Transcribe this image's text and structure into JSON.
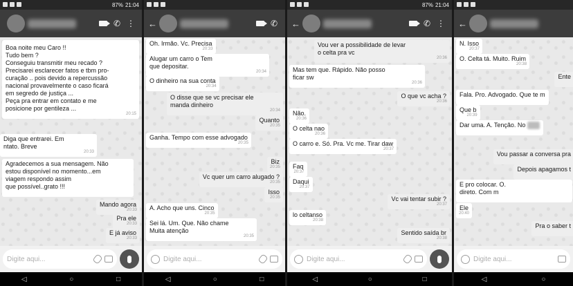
{
  "status": {
    "battery": "87%",
    "time": "21:04"
  },
  "input": {
    "placeholder": "Digite aqui..."
  },
  "nav": {
    "back": "◁",
    "home": "○",
    "recent": "□"
  },
  "panel1": {
    "messages": [
      {
        "dir": "in",
        "text": "Boa noite meu Caro !!\nTudo bem ?\nConseguiu transmitir meu recado ?\nPrecisarei esclarecer fatos e tbm pro-\ncuração .. pois devido a repercussão\nnacional provavelmente o caso ficará\nem segredo de justiça ...\nPeça pra entrar em contato e me\nposicione por gentileza ...",
        "time": "20:15"
      },
      {
        "dir": "in",
        "text": "Diga que entrarei. Em\nntato. Breve",
        "time": "20:33"
      },
      {
        "dir": "in",
        "text": "Agradecemos a sua mensagem. Não\nestou disponível no momento...em\nviagem                 respondo assim\nque possível..grato !!!",
        "time": ""
      },
      {
        "dir": "out",
        "text": "Mando agora",
        "time": "20:33"
      },
      {
        "dir": "out",
        "text": "Pra ele",
        "time": "20:33"
      },
      {
        "dir": "out",
        "text": "E já aviso",
        "time": "20:33"
      }
    ]
  },
  "panel2": {
    "messages": [
      {
        "dir": "in",
        "text": "Oh. Irmão. Vc. Precisa",
        "time": "20:33"
      },
      {
        "dir": "in",
        "text": "Alugar um carro o              Tem\nque depositar.",
        "time": "20:34"
      },
      {
        "dir": "in",
        "text": "O dinheiro na sua conta",
        "time": "20:34"
      },
      {
        "dir": "out",
        "text": "O          disse que se vc precisar ele\nmanda dinheiro",
        "time": "20:34"
      },
      {
        "dir": "out",
        "text": "Quanto",
        "time": "20:35"
      },
      {
        "dir": "in",
        "text": "Ganha. Tempo com esse advogado",
        "time": "20:35"
      },
      {
        "dir": "out",
        "text": "Biz",
        "time": "20:35"
      },
      {
        "dir": "out",
        "text": "Vc quer um carro alugado ?",
        "time": "20:35"
      },
      {
        "dir": "out",
        "text": "Isso",
        "time": "20:35"
      },
      {
        "dir": "in",
        "text": "A. Acho que uns. Cinco",
        "time": "20:35"
      },
      {
        "dir": "in",
        "text": "Sei lá. Um. Que. Não chame\nMuita atenção",
        "time": "20:35"
      }
    ]
  },
  "panel3": {
    "messages": [
      {
        "dir": "out",
        "text": "Vou ver a possibilidade de levar\no celta pra vc",
        "time": "20:36"
      },
      {
        "dir": "in",
        "text": "Mas tem que. Rápido. Não posso\nficar sw",
        "time": "20:36"
      },
      {
        "dir": "out",
        "text": "O que vc acha ?",
        "time": "20:36"
      },
      {
        "dir": "in",
        "text": "Não.",
        "time": "20:36"
      },
      {
        "dir": "in",
        "text": "O celta nao",
        "time": "20:36"
      },
      {
        "dir": "in",
        "text": "O carro e. Só. Pra. Vc me. Tirar daw",
        "time": "20:37"
      },
      {
        "dir": "in",
        "text": "Faq",
        "time": "20:37"
      },
      {
        "dir": "in",
        "text": "Daqui",
        "time": "20:37"
      },
      {
        "dir": "out",
        "text": "Vc vai tentar subir ?",
        "time": "20:37"
      },
      {
        "dir": "in",
        "text": "lo celtanso",
        "time": "20:38"
      },
      {
        "dir": "out",
        "text": "Sentido saída br",
        "time": "20:38"
      }
    ]
  },
  "panel4": {
    "messages": [
      {
        "dir": "in",
        "text": "N.  Isso",
        "time": "20:37"
      },
      {
        "dir": "in",
        "text": "O. Celta tá. Muito. Ruim",
        "time": "20:38"
      },
      {
        "dir": "out",
        "text": "Ente",
        "time": ""
      },
      {
        "dir": "in",
        "text": "Fala. Pro. Advogado. Que te m",
        "time": ""
      },
      {
        "dir": "in",
        "text": "Que b",
        "time": "20:39"
      },
      {
        "dir": "in",
        "text": "Dar uma. A. Tenção. No",
        "time": ""
      },
      {
        "dir": "out",
        "text": "Vou passar a conversa pra",
        "time": ""
      },
      {
        "dir": "out",
        "text": "Depois apagamos t",
        "time": ""
      },
      {
        "dir": "in",
        "text": "E pro              colocar. O.\ndireto. Com m",
        "time": ""
      },
      {
        "dir": "in",
        "text": "Ele",
        "time": "20:40"
      },
      {
        "dir": "out",
        "text": "Pra o         saber t",
        "time": ""
      }
    ]
  }
}
